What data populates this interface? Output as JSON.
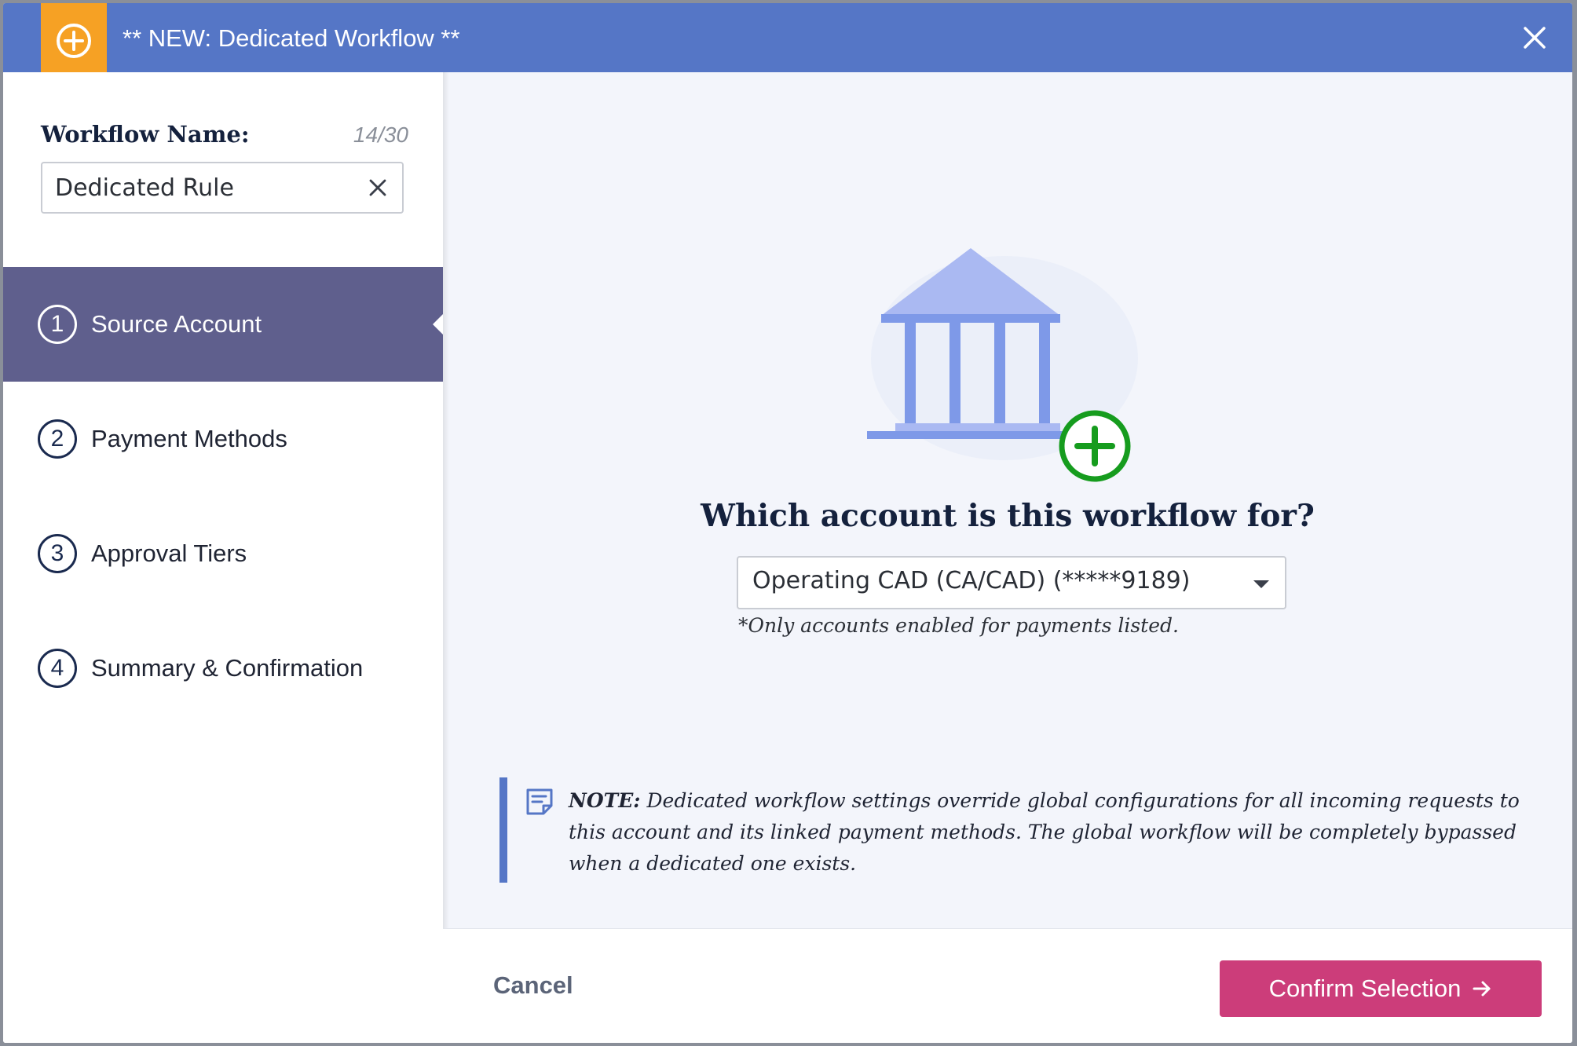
{
  "header": {
    "title": "** NEW: Dedicated Workflow **",
    "ribbon_icon": "plus-circle-icon",
    "close_icon": "close-icon"
  },
  "sidebar": {
    "workflow_name_label": "Workflow Name:",
    "workflow_name_count": "14/30",
    "workflow_name_value": "Dedicated Rule",
    "steps": [
      {
        "number": "1",
        "label": "Source Account",
        "active": true
      },
      {
        "number": "2",
        "label": "Payment Methods",
        "active": false
      },
      {
        "number": "3",
        "label": "Approval Tiers",
        "active": false
      },
      {
        "number": "4",
        "label": "Summary & Confirmation",
        "active": false
      }
    ]
  },
  "main": {
    "illustration_icon": "bank-add-icon",
    "question": "Which account is this workflow for?",
    "account_select_value": "Operating CAD (CA/CAD) (*****9189)",
    "account_hint": "*Only accounts enabled for payments listed.",
    "note": {
      "label": "NOTE:",
      "text": "Dedicated workflow settings override global configurations for all incoming requests to this account and its linked payment methods. The global workflow will be completely bypassed when a dedicated one exists."
    }
  },
  "footer": {
    "cancel_label": "Cancel",
    "confirm_label": "Confirm Selection"
  },
  "colors": {
    "header": "#5576c6",
    "ribbon": "#f6a124",
    "active_step": "#5f5f8d",
    "confirm": "#cc3d7a",
    "plus_badge": "#169c1e"
  }
}
